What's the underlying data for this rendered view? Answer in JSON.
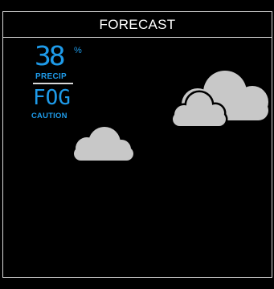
{
  "header": {
    "title": "FORECAST"
  },
  "precipitation": {
    "value": "38",
    "unit": "%",
    "label": "PRECIP"
  },
  "condition": {
    "value": "FOG",
    "label": "CAUTION"
  },
  "icons": {
    "weather": "clouds-icon"
  },
  "colors": {
    "background": "#000000",
    "frame": "#d9d9d9",
    "accent": "#1e9bea",
    "cloud": "#c8c8c8"
  }
}
